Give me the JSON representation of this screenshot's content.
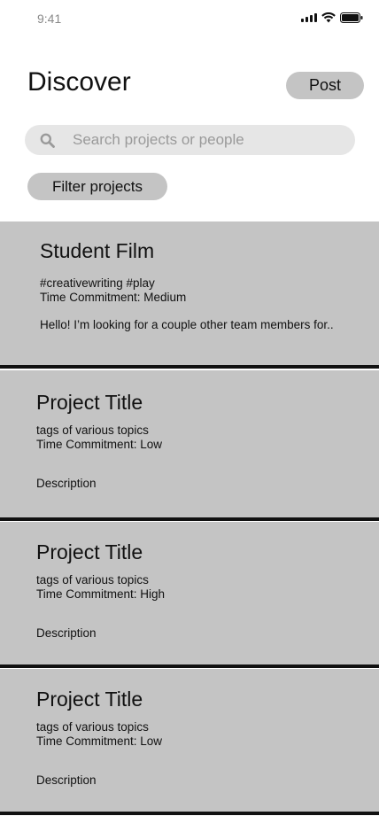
{
  "status_bar": {
    "time": "9:41",
    "icons": [
      "signal-icon",
      "wifi-icon",
      "battery-icon"
    ]
  },
  "header": {
    "title": "Discover",
    "post_label": "Post"
  },
  "search": {
    "placeholder": "Search projects or people",
    "value": "",
    "icon": "search-icon"
  },
  "filter": {
    "label": "Filter projects"
  },
  "projects": [
    {
      "title": "Student Film",
      "tags": "#creativewriting #play",
      "commitment": "Time Commitment: Medium",
      "description": "Hello! I’m looking for a couple other team members for.."
    },
    {
      "title": "Project Title",
      "tags": "tags of various topics",
      "commitment": "Time Commitment: Low",
      "description": "Description"
    },
    {
      "title": "Project Title",
      "tags": "tags of various topics",
      "commitment": "Time Commitment: High",
      "description": "Description"
    },
    {
      "title": "Project Title",
      "tags": "tags of various topics",
      "commitment": "Time Commitment: Low",
      "description": "Description"
    }
  ],
  "colors": {
    "card_background": "#c4c4c4",
    "button_background": "#c4c4c4",
    "search_background": "#e6e6e6",
    "divider": "#111111",
    "background": "#ffffff"
  }
}
